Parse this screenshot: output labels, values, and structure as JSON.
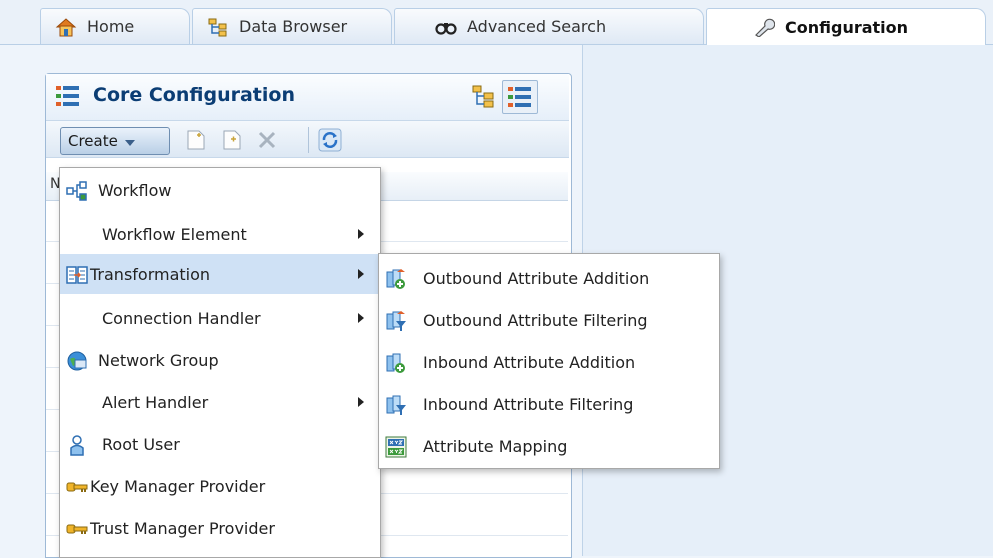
{
  "tabs": [
    {
      "label": "Home",
      "icon": "home-icon"
    },
    {
      "label": "Data Browser",
      "icon": "tree-icon"
    },
    {
      "label": "Advanced Search",
      "icon": "binoculars-icon"
    },
    {
      "label": "Configuration",
      "icon": "wrench-icon",
      "active": true
    }
  ],
  "panel": {
    "title": "Core Configuration",
    "create_label": "Create",
    "table_header_fragment": "N"
  },
  "menu": {
    "items": [
      {
        "label": "Workflow",
        "icon": "workflow-icon",
        "submenu": false
      },
      {
        "label": "Workflow Element",
        "icon": "",
        "submenu": true
      },
      {
        "label": "Transformation",
        "icon": "transformation-icon",
        "submenu": true,
        "highlighted": true
      },
      {
        "label": "Connection Handler",
        "icon": "",
        "submenu": true
      },
      {
        "label": "Network Group",
        "icon": "globe-icon",
        "submenu": false
      },
      {
        "label": "Alert Handler",
        "icon": "",
        "submenu": true
      },
      {
        "label": "Root User",
        "icon": "user-icon",
        "submenu": false
      },
      {
        "label": "Key Manager Provider",
        "icon": "key-icon",
        "submenu": false
      },
      {
        "label": "Trust Manager Provider",
        "icon": "key-icon",
        "submenu": false
      }
    ]
  },
  "submenu": {
    "items": [
      {
        "label": "Outbound Attribute Addition",
        "icon": "attribute-add-icon"
      },
      {
        "label": "Outbound Attribute Filtering",
        "icon": "attribute-filter-icon"
      },
      {
        "label": "Inbound Attribute Addition",
        "icon": "attribute-add-icon"
      },
      {
        "label": "Inbound Attribute Filtering",
        "icon": "attribute-filter-icon"
      },
      {
        "label": "Attribute Mapping",
        "icon": "attribute-mapping-icon"
      }
    ]
  },
  "colors": {
    "accent": "#0b3d74",
    "highlight": "#cfe1f5",
    "panel_border": "#9eb9d6"
  }
}
